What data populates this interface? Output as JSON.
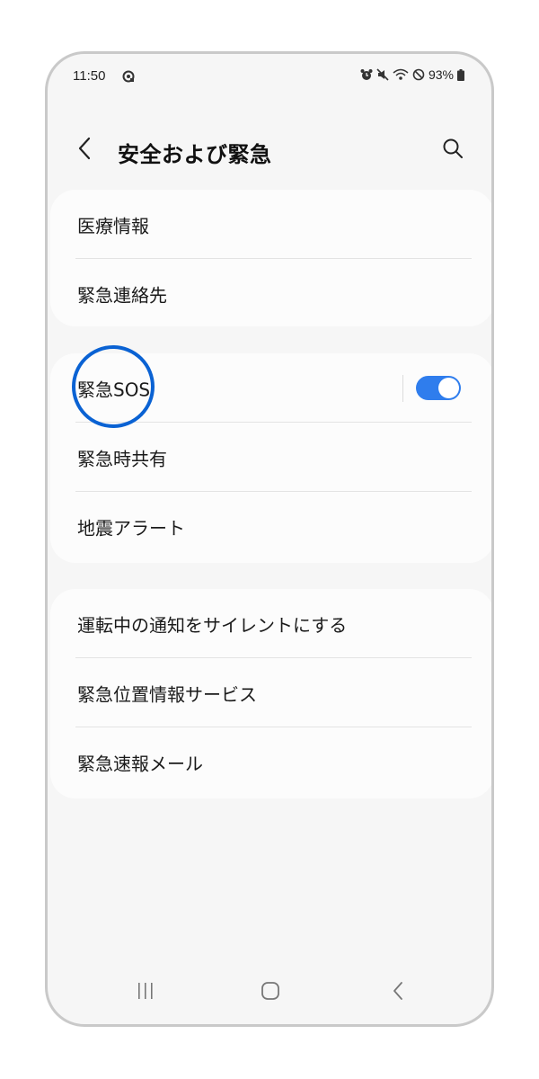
{
  "status_bar": {
    "time": "11:50",
    "battery_percent": "93%",
    "icons": [
      "alarm-icon",
      "mute-icon",
      "wifi-icon",
      "do-not-disturb-icon",
      "battery-icon"
    ]
  },
  "header": {
    "title": "安全および緊急",
    "back_icon": "chevron-left-icon",
    "search_icon": "search-icon"
  },
  "groups": [
    {
      "items": [
        {
          "label": "医療情報"
        },
        {
          "label": "緊急連絡先"
        }
      ]
    },
    {
      "items": [
        {
          "label": "緊急SOS",
          "toggle": true
        },
        {
          "label": "緊急時共有"
        },
        {
          "label": "地震アラート"
        }
      ]
    },
    {
      "items": [
        {
          "label": "運転中の通知をサイレントにする"
        },
        {
          "label": "緊急位置情報サービス"
        },
        {
          "label": "緊急速報メール"
        }
      ]
    }
  ],
  "colors": {
    "accent": "#2f7ded",
    "highlight": "#0a62d3",
    "background": "#f6f6f6",
    "card": "#fcfcfc"
  },
  "nav_bar": {
    "icons": [
      "recent-apps-icon",
      "home-icon",
      "back-icon"
    ]
  }
}
